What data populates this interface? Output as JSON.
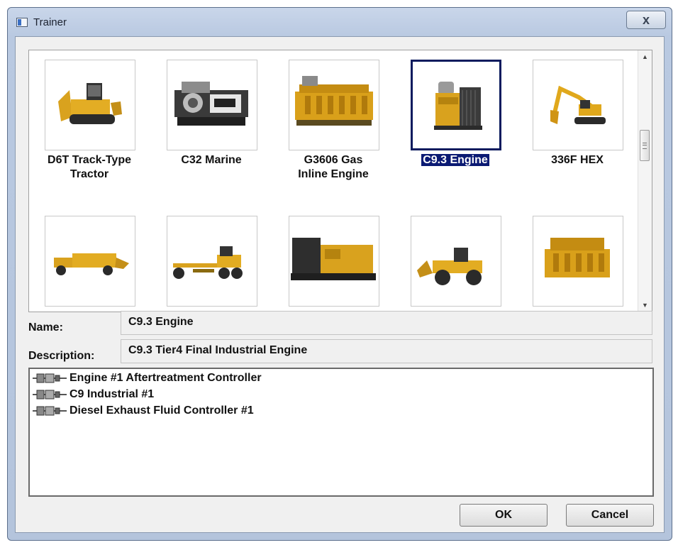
{
  "window": {
    "title": "Trainer",
    "close_glyph": "x"
  },
  "gallery": {
    "items": [
      {
        "label_line1": "D6T Track-Type",
        "label_line2": "Tractor",
        "image": "track-type-tractor-icon"
      },
      {
        "label_line1": "C32 Marine",
        "label_line2": "",
        "image": "marine-engine-icon"
      },
      {
        "label_line1": "G3606 Gas",
        "label_line2": "Inline Engine",
        "image": "gas-inline-engine-icon"
      },
      {
        "label_line1": "C9.3 Engine",
        "label_line2": "",
        "image": "industrial-engine-icon",
        "selected": true
      },
      {
        "label_line1": "336F HEX",
        "label_line2": "",
        "image": "excavator-icon"
      },
      {
        "label_line1": "",
        "label_line2": "",
        "image": "wheel-tractor-scraper-icon"
      },
      {
        "label_line1": "",
        "label_line2": "",
        "image": "motor-grader-icon"
      },
      {
        "label_line1": "",
        "label_line2": "",
        "image": "generator-set-icon"
      },
      {
        "label_line1": "",
        "label_line2": "",
        "image": "wheel-loader-icon"
      },
      {
        "label_line1": "",
        "label_line2": "",
        "image": "large-engine-icon"
      }
    ],
    "scroll_up_glyph": "▲",
    "scroll_down_glyph": "▼"
  },
  "details": {
    "name_label": "Name:",
    "name_value": "C9.3 Engine",
    "description_label": "Description:",
    "description_value": "C9.3 Tier4 Final Industrial Engine"
  },
  "tree": {
    "items": [
      {
        "label": "Engine #1 Aftertreatment Controller"
      },
      {
        "label": "C9 Industrial #1"
      },
      {
        "label": "Diesel Exhaust Fluid Controller #1"
      }
    ]
  },
  "buttons": {
    "ok": "OK",
    "cancel": "Cancel"
  },
  "colors": {
    "selection": "#0b1a73",
    "cat_yellow": "#e0a81c",
    "title_gradient": "#b9c9e1"
  }
}
